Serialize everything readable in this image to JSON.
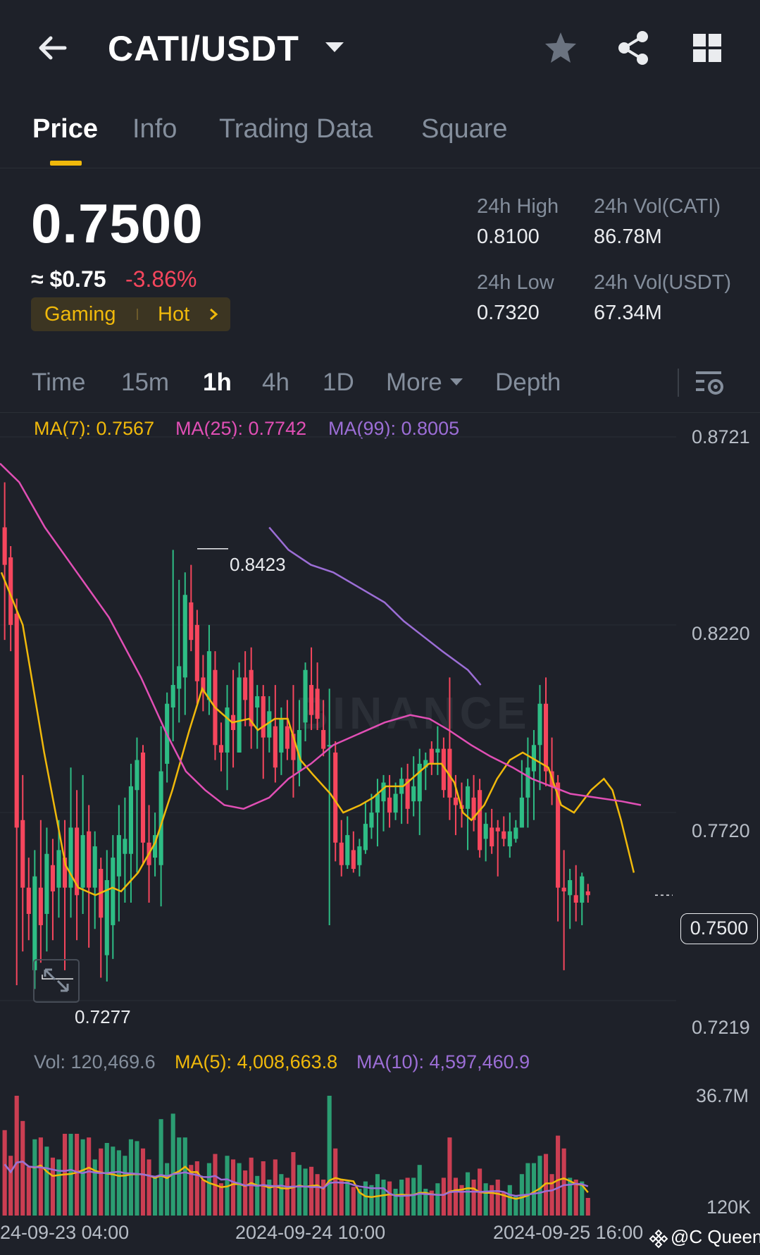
{
  "header": {
    "pair": "CATI/USDT",
    "icons": [
      "back-arrow-icon",
      "caret-down-icon",
      "star-icon",
      "share-icon",
      "grid-icon"
    ]
  },
  "tabs": [
    {
      "label": "Price",
      "active": true
    },
    {
      "label": "Info",
      "active": false
    },
    {
      "label": "Trading Data",
      "active": false
    },
    {
      "label": "Square",
      "active": false
    }
  ],
  "ticker": {
    "last_price": "0.7500",
    "fiat_price": "≈ $0.75",
    "change_pct": "-3.86%",
    "tags": [
      "Gaming",
      "Hot"
    ],
    "high_label": "24h High",
    "high_value": "0.8100",
    "low_label": "24h Low",
    "low_value": "0.7320",
    "vol_base_label": "24h Vol(CATI)",
    "vol_base_value": "86.78M",
    "vol_quote_label": "24h Vol(USDT)",
    "vol_quote_value": "67.34M"
  },
  "intervals": {
    "items": [
      "Time",
      "15m",
      "1h",
      "4h",
      "1D",
      "More",
      "Depth"
    ],
    "active": "1h"
  },
  "legend": {
    "ma7": "MA(7): 0.7567",
    "ma25": "MA(25): 0.7742",
    "ma99": "MA(99): 0.8005",
    "vol": "Vol: 120,469.6",
    "vol_ma5": "MA(5): 4,008,663.8",
    "vol_ma10": "MA(10): 4,597,460.9"
  },
  "colors": {
    "up": "#2ebd85",
    "down": "#f6465d",
    "ma7": "#f0b90b",
    "ma25": "#e14fb5",
    "ma99": "#9c6ed6",
    "accent": "#f0b90b"
  },
  "watermark": "BINANCE",
  "credit": "@C Queen",
  "chart_data": {
    "type": "candlestick",
    "price_axis_ticks": [
      "0.8721",
      "0.8220",
      "0.7720",
      "0.7219"
    ],
    "ylim": [
      0.7219,
      0.8721
    ],
    "last_price_tag": "0.7500",
    "max_label": "0.8423",
    "min_label": "0.7277",
    "volume_axis_ticks": [
      "36.7M",
      "120K"
    ],
    "x_tick_labels": [
      "24-09-23 04:00",
      "2024-09-24 10:00",
      "2024-09-25 16:00"
    ],
    "candles": [
      {
        "o": 0.848,
        "h": 0.86,
        "l": 0.818,
        "c": 0.838
      },
      {
        "o": 0.84,
        "h": 0.843,
        "l": 0.815,
        "c": 0.822
      },
      {
        "o": 0.825,
        "h": 0.829,
        "l": 0.726,
        "c": 0.768
      },
      {
        "o": 0.77,
        "h": 0.782,
        "l": 0.735,
        "c": 0.752
      },
      {
        "o": 0.752,
        "h": 0.76,
        "l": 0.738,
        "c": 0.745
      },
      {
        "o": 0.73,
        "h": 0.762,
        "l": 0.725,
        "c": 0.755
      },
      {
        "o": 0.752,
        "h": 0.77,
        "l": 0.732,
        "c": 0.742
      },
      {
        "o": 0.745,
        "h": 0.768,
        "l": 0.735,
        "c": 0.761
      },
      {
        "o": 0.758,
        "h": 0.765,
        "l": 0.738,
        "c": 0.751
      },
      {
        "o": 0.752,
        "h": 0.77,
        "l": 0.744,
        "c": 0.762
      },
      {
        "o": 0.76,
        "h": 0.77,
        "l": 0.73,
        "c": 0.752
      },
      {
        "o": 0.752,
        "h": 0.784,
        "l": 0.744,
        "c": 0.768
      },
      {
        "o": 0.768,
        "h": 0.778,
        "l": 0.738,
        "c": 0.75
      },
      {
        "o": 0.752,
        "h": 0.782,
        "l": 0.745,
        "c": 0.766
      },
      {
        "o": 0.767,
        "h": 0.774,
        "l": 0.736,
        "c": 0.752
      },
      {
        "o": 0.752,
        "h": 0.767,
        "l": 0.741,
        "c": 0.763
      },
      {
        "o": 0.757,
        "h": 0.76,
        "l": 0.728,
        "c": 0.744
      },
      {
        "o": 0.734,
        "h": 0.762,
        "l": 0.727,
        "c": 0.754
      },
      {
        "o": 0.742,
        "h": 0.766,
        "l": 0.733,
        "c": 0.76
      },
      {
        "o": 0.755,
        "h": 0.774,
        "l": 0.743,
        "c": 0.766
      },
      {
        "o": 0.761,
        "h": 0.776,
        "l": 0.748,
        "c": 0.765
      },
      {
        "o": 0.761,
        "h": 0.785,
        "l": 0.748,
        "c": 0.779
      },
      {
        "o": 0.778,
        "h": 0.792,
        "l": 0.756,
        "c": 0.786
      },
      {
        "o": 0.788,
        "h": 0.79,
        "l": 0.758,
        "c": 0.764
      },
      {
        "o": 0.764,
        "h": 0.774,
        "l": 0.748,
        "c": 0.758
      },
      {
        "o": 0.76,
        "h": 0.772,
        "l": 0.755,
        "c": 0.766
      },
      {
        "o": 0.758,
        "h": 0.795,
        "l": 0.747,
        "c": 0.783
      },
      {
        "o": 0.785,
        "h": 0.804,
        "l": 0.78,
        "c": 0.801
      },
      {
        "o": 0.8,
        "h": 0.842,
        "l": 0.791,
        "c": 0.806
      },
      {
        "o": 0.805,
        "h": 0.834,
        "l": 0.796,
        "c": 0.811
      },
      {
        "o": 0.808,
        "h": 0.836,
        "l": 0.798,
        "c": 0.83
      },
      {
        "o": 0.828,
        "h": 0.838,
        "l": 0.815,
        "c": 0.818
      },
      {
        "o": 0.822,
        "h": 0.826,
        "l": 0.801,
        "c": 0.807
      },
      {
        "o": 0.808,
        "h": 0.814,
        "l": 0.799,
        "c": 0.804
      },
      {
        "o": 0.802,
        "h": 0.822,
        "l": 0.798,
        "c": 0.815
      },
      {
        "o": 0.81,
        "h": 0.815,
        "l": 0.786,
        "c": 0.79
      },
      {
        "o": 0.79,
        "h": 0.796,
        "l": 0.783,
        "c": 0.788
      },
      {
        "o": 0.788,
        "h": 0.806,
        "l": 0.778,
        "c": 0.8
      },
      {
        "o": 0.798,
        "h": 0.81,
        "l": 0.784,
        "c": 0.794
      },
      {
        "o": 0.788,
        "h": 0.812,
        "l": 0.788,
        "c": 0.808
      },
      {
        "o": 0.808,
        "h": 0.815,
        "l": 0.795,
        "c": 0.802
      },
      {
        "o": 0.81,
        "h": 0.816,
        "l": 0.789,
        "c": 0.795
      },
      {
        "o": 0.8,
        "h": 0.806,
        "l": 0.789,
        "c": 0.803
      },
      {
        "o": 0.803,
        "h": 0.806,
        "l": 0.781,
        "c": 0.792
      },
      {
        "o": 0.792,
        "h": 0.803,
        "l": 0.788,
        "c": 0.799
      },
      {
        "o": 0.795,
        "h": 0.806,
        "l": 0.78,
        "c": 0.784
      },
      {
        "o": 0.788,
        "h": 0.8,
        "l": 0.782,
        "c": 0.797
      },
      {
        "o": 0.795,
        "h": 0.802,
        "l": 0.786,
        "c": 0.789
      },
      {
        "o": 0.793,
        "h": 0.806,
        "l": 0.776,
        "c": 0.786
      },
      {
        "o": 0.783,
        "h": 0.802,
        "l": 0.779,
        "c": 0.794
      },
      {
        "o": 0.796,
        "h": 0.812,
        "l": 0.791,
        "c": 0.81
      },
      {
        "o": 0.806,
        "h": 0.816,
        "l": 0.794,
        "c": 0.798
      },
      {
        "o": 0.805,
        "h": 0.812,
        "l": 0.794,
        "c": 0.797
      },
      {
        "o": 0.794,
        "h": 0.802,
        "l": 0.787,
        "c": 0.789
      },
      {
        "o": 0.79,
        "h": 0.805,
        "l": 0.742,
        "c": 0.79
      },
      {
        "o": 0.788,
        "h": 0.791,
        "l": 0.759,
        "c": 0.764
      },
      {
        "o": 0.764,
        "h": 0.77,
        "l": 0.755,
        "c": 0.758
      },
      {
        "o": 0.758,
        "h": 0.771,
        "l": 0.757,
        "c": 0.766
      },
      {
        "o": 0.762,
        "h": 0.767,
        "l": 0.756,
        "c": 0.757
      },
      {
        "o": 0.758,
        "h": 0.765,
        "l": 0.755,
        "c": 0.763
      },
      {
        "o": 0.762,
        "h": 0.775,
        "l": 0.761,
        "c": 0.769
      },
      {
        "o": 0.768,
        "h": 0.777,
        "l": 0.765,
        "c": 0.772
      },
      {
        "o": 0.772,
        "h": 0.781,
        "l": 0.763,
        "c": 0.777
      },
      {
        "o": 0.775,
        "h": 0.782,
        "l": 0.767,
        "c": 0.78
      },
      {
        "o": 0.776,
        "h": 0.782,
        "l": 0.768,
        "c": 0.772
      },
      {
        "o": 0.772,
        "h": 0.78,
        "l": 0.77,
        "c": 0.777
      },
      {
        "o": 0.777,
        "h": 0.784,
        "l": 0.769,
        "c": 0.781
      },
      {
        "o": 0.781,
        "h": 0.785,
        "l": 0.769,
        "c": 0.773
      },
      {
        "o": 0.775,
        "h": 0.787,
        "l": 0.771,
        "c": 0.779
      },
      {
        "o": 0.775,
        "h": 0.789,
        "l": 0.766,
        "c": 0.785
      },
      {
        "o": 0.784,
        "h": 0.788,
        "l": 0.778,
        "c": 0.786
      },
      {
        "o": 0.789,
        "h": 0.791,
        "l": 0.782,
        "c": 0.785
      },
      {
        "o": 0.788,
        "h": 0.795,
        "l": 0.782,
        "c": 0.789
      },
      {
        "o": 0.789,
        "h": 0.792,
        "l": 0.776,
        "c": 0.778
      },
      {
        "o": 0.789,
        "h": 0.808,
        "l": 0.77,
        "c": 0.776
      },
      {
        "o": 0.776,
        "h": 0.782,
        "l": 0.766,
        "c": 0.774
      },
      {
        "o": 0.774,
        "h": 0.78,
        "l": 0.768,
        "c": 0.773
      },
      {
        "o": 0.773,
        "h": 0.781,
        "l": 0.762,
        "c": 0.779
      },
      {
        "o": 0.776,
        "h": 0.782,
        "l": 0.767,
        "c": 0.77
      },
      {
        "o": 0.778,
        "h": 0.781,
        "l": 0.76,
        "c": 0.762
      },
      {
        "o": 0.765,
        "h": 0.772,
        "l": 0.759,
        "c": 0.769
      },
      {
        "o": 0.768,
        "h": 0.773,
        "l": 0.761,
        "c": 0.763
      },
      {
        "o": 0.768,
        "h": 0.77,
        "l": 0.755,
        "c": 0.767
      },
      {
        "o": 0.767,
        "h": 0.771,
        "l": 0.763,
        "c": 0.765
      },
      {
        "o": 0.763,
        "h": 0.772,
        "l": 0.76,
        "c": 0.767
      },
      {
        "o": 0.765,
        "h": 0.77,
        "l": 0.764,
        "c": 0.768
      },
      {
        "o": 0.768,
        "h": 0.786,
        "l": 0.768,
        "c": 0.776
      },
      {
        "o": 0.776,
        "h": 0.792,
        "l": 0.768,
        "c": 0.784
      },
      {
        "o": 0.783,
        "h": 0.794,
        "l": 0.77,
        "c": 0.79
      },
      {
        "o": 0.79,
        "h": 0.806,
        "l": 0.778,
        "c": 0.801
      },
      {
        "o": 0.801,
        "h": 0.808,
        "l": 0.779,
        "c": 0.783
      },
      {
        "o": 0.783,
        "h": 0.792,
        "l": 0.774,
        "c": 0.779
      },
      {
        "o": 0.78,
        "h": 0.782,
        "l": 0.743,
        "c": 0.752
      },
      {
        "o": 0.752,
        "h": 0.762,
        "l": 0.73,
        "c": 0.751
      },
      {
        "o": 0.75,
        "h": 0.757,
        "l": 0.741,
        "c": 0.754
      },
      {
        "o": 0.75,
        "h": 0.758,
        "l": 0.743,
        "c": 0.748
      },
      {
        "o": 0.748,
        "h": 0.756,
        "l": 0.742,
        "c": 0.755
      },
      {
        "o": 0.751,
        "h": 0.753,
        "l": 0.748,
        "c": 0.75
      }
    ],
    "ma_series": [
      {
        "name": "MA(7)",
        "values": [
          [
            0,
            0.836
          ],
          [
            5,
            0.822
          ],
          [
            10,
            0.788
          ],
          [
            15,
            0.758
          ],
          [
            18,
            0.752
          ],
          [
            22,
            0.75
          ],
          [
            26,
            0.752
          ],
          [
            28,
            0.751
          ],
          [
            32,
            0.756
          ],
          [
            36,
            0.764
          ],
          [
            40,
            0.778
          ],
          [
            44,
            0.794
          ],
          [
            47,
            0.805
          ],
          [
            50,
            0.8
          ],
          [
            54,
            0.796
          ],
          [
            58,
            0.797
          ],
          [
            60,
            0.794
          ],
          [
            64,
            0.797
          ],
          [
            67,
            0.797
          ],
          [
            70,
            0.786
          ],
          [
            73,
            0.782
          ],
          [
            77,
            0.777
          ],
          [
            80,
            0.772
          ],
          [
            84,
            0.774
          ],
          [
            87,
            0.776
          ],
          [
            90,
            0.779
          ],
          [
            94,
            0.779
          ],
          [
            97,
            0.782
          ],
          [
            100,
            0.785
          ],
          [
            103,
            0.785
          ],
          [
            106,
            0.78
          ],
          [
            108,
            0.772
          ],
          [
            110,
            0.77
          ],
          [
            113,
            0.774
          ],
          [
            116,
            0.781
          ],
          [
            119,
            0.786
          ],
          [
            122,
            0.788
          ],
          [
            125,
            0.786
          ],
          [
            128,
            0.784
          ],
          [
            131,
            0.774
          ],
          [
            134,
            0.772
          ],
          [
            138,
            0.778
          ],
          [
            141,
            0.781
          ],
          [
            143,
            0.778
          ],
          [
            145,
            0.77
          ],
          [
            148,
            0.756
          ]
        ]
      },
      {
        "name": "MA(25)",
        "values": [
          [
            0,
            0.865
          ],
          [
            6,
            0.86
          ],
          [
            14,
            0.848
          ],
          [
            24,
            0.836
          ],
          [
            34,
            0.824
          ],
          [
            44,
            0.808
          ],
          [
            52,
            0.793
          ],
          [
            58,
            0.783
          ],
          [
            64,
            0.778
          ],
          [
            70,
            0.774
          ],
          [
            76,
            0.773
          ],
          [
            84,
            0.776
          ],
          [
            90,
            0.781
          ],
          [
            97,
            0.785
          ],
          [
            104,
            0.79
          ],
          [
            112,
            0.793
          ],
          [
            120,
            0.796
          ],
          [
            128,
            0.798
          ],
          [
            134,
            0.797
          ],
          [
            140,
            0.794
          ],
          [
            147,
            0.79
          ],
          [
            153,
            0.787
          ],
          [
            160,
            0.784
          ],
          [
            166,
            0.781
          ],
          [
            172,
            0.779
          ],
          [
            178,
            0.777
          ],
          [
            186,
            0.776
          ],
          [
            194,
            0.775
          ],
          [
            200,
            0.774
          ]
        ]
      },
      {
        "name": "MA(99)",
        "values": [
          [
            84,
            0.848
          ],
          [
            90,
            0.842
          ],
          [
            97,
            0.838
          ],
          [
            104,
            0.836
          ],
          [
            112,
            0.832
          ],
          [
            120,
            0.828
          ],
          [
            126,
            0.823
          ],
          [
            132,
            0.819
          ],
          [
            138,
            0.815
          ],
          [
            146,
            0.81
          ],
          [
            150,
            0.806
          ]
        ]
      }
    ],
    "volume_series": [
      {
        "name": "MA(5)",
        "values": "see script"
      },
      {
        "name": "MA(10)",
        "values": "see script"
      }
    ]
  }
}
